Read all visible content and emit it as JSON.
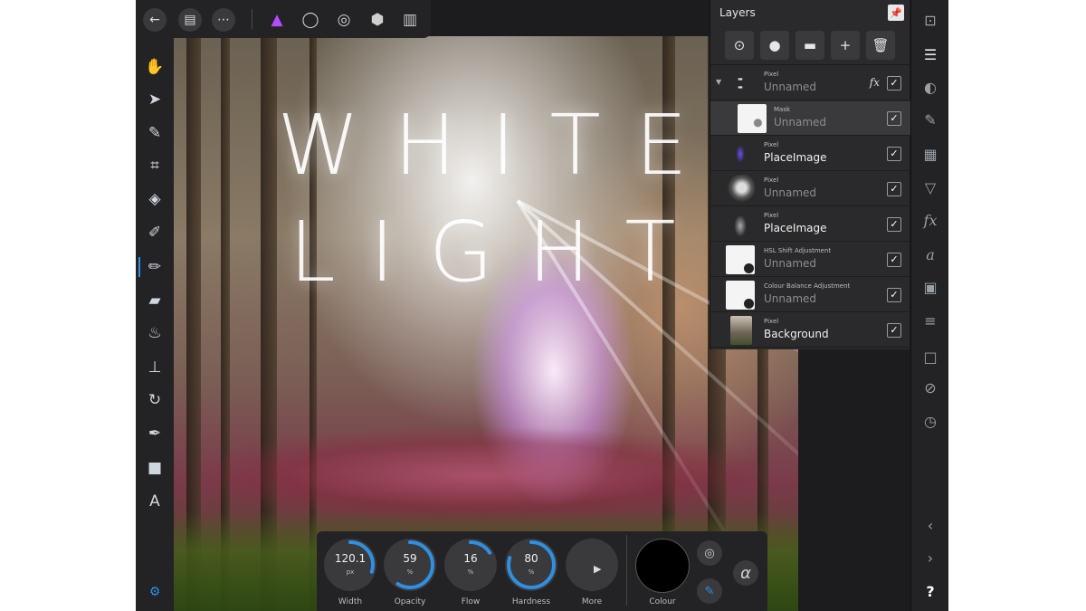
{
  "canvas": {
    "artwork_title": "WHITE\nLIGHT"
  },
  "top_toolbar": {
    "back_icon": "back-arrow-icon",
    "document_icon": "document-icon",
    "more_icon": "ellipsis-icon",
    "personas": [
      "photo-persona-icon",
      "liquify-persona-icon",
      "develop-persona-icon",
      "tone-mapping-persona-icon",
      "export-persona-icon"
    ]
  },
  "layers_panel": {
    "title": "Layers",
    "pin_icon": "pin-icon",
    "actions": [
      "blend-options-icon",
      "mask-icon",
      "folder-icon",
      "add-layer-icon",
      "delete-icon"
    ],
    "layers": [
      {
        "type": "Pixel",
        "name": "Unnamed",
        "visible": "✓",
        "fx": "fx",
        "expand": "▼",
        "thumb": "white-light-text"
      },
      {
        "type": "Mask",
        "name": "Unnamed",
        "visible": "✓",
        "selected": true,
        "thumb": "mask"
      },
      {
        "type": "Pixel",
        "name": "PlaceImage",
        "visible": "✓",
        "thumb": "purple-flare"
      },
      {
        "type": "Pixel",
        "name": "Unnamed",
        "visible": "✓",
        "thumb": "smoke"
      },
      {
        "type": "Pixel",
        "name": "PlaceImage",
        "visible": "✓",
        "thumb": "smoke-dark"
      },
      {
        "type": "HSL Shift Adjustment",
        "name": "Unnamed",
        "visible": "✓",
        "thumb": "adjustment"
      },
      {
        "type": "Colour Balance Adjustment",
        "name": "Unnamed",
        "visible": "✓",
        "thumb": "adjustment"
      },
      {
        "type": "Pixel",
        "name": "Background",
        "visible": "✓",
        "thumb": "forest"
      }
    ]
  },
  "context_toolbar": {
    "dials": [
      {
        "label": "Width",
        "value": "120.1",
        "unit": "px",
        "fraction": 0.3
      },
      {
        "label": "Opacity",
        "value": "59",
        "unit": "%",
        "fraction": 0.59
      },
      {
        "label": "Flow",
        "value": "16",
        "unit": "%",
        "fraction": 0.16
      },
      {
        "label": "Hardness",
        "value": "80",
        "unit": "%",
        "fraction": 0.8
      }
    ],
    "more_label": "More",
    "colour_label": "Colour",
    "colour_value": "#000000",
    "alpha_symbol": "α",
    "accent_color": "#2f8fe0"
  },
  "tools": [
    "hand-tool-icon",
    "move-tool-icon",
    "color-picker-icon",
    "crop-icon",
    "fill-icon",
    "selection-brush-icon",
    "paint-brush-icon",
    "erase-brush-icon",
    "dodge-burn-icon",
    "clone-stamp-icon",
    "inpainting-icon",
    "pen-tool-icon",
    "rectangle-tool-icon",
    "text-tool-icon",
    "assistant-icon"
  ],
  "studio_icons": [
    "navigator-icon",
    "layers-icon",
    "colour-icon",
    "brushes-icon",
    "swatches-icon",
    "channels-filter-icon",
    "effects-icon",
    "styles-icon",
    "stock-icon",
    "adjustments-icon",
    "transform-icon",
    "history-icon",
    "clock-icon",
    "chevron-left-icon",
    "chevron-right-icon",
    "help-icon"
  ],
  "help_label": "?"
}
